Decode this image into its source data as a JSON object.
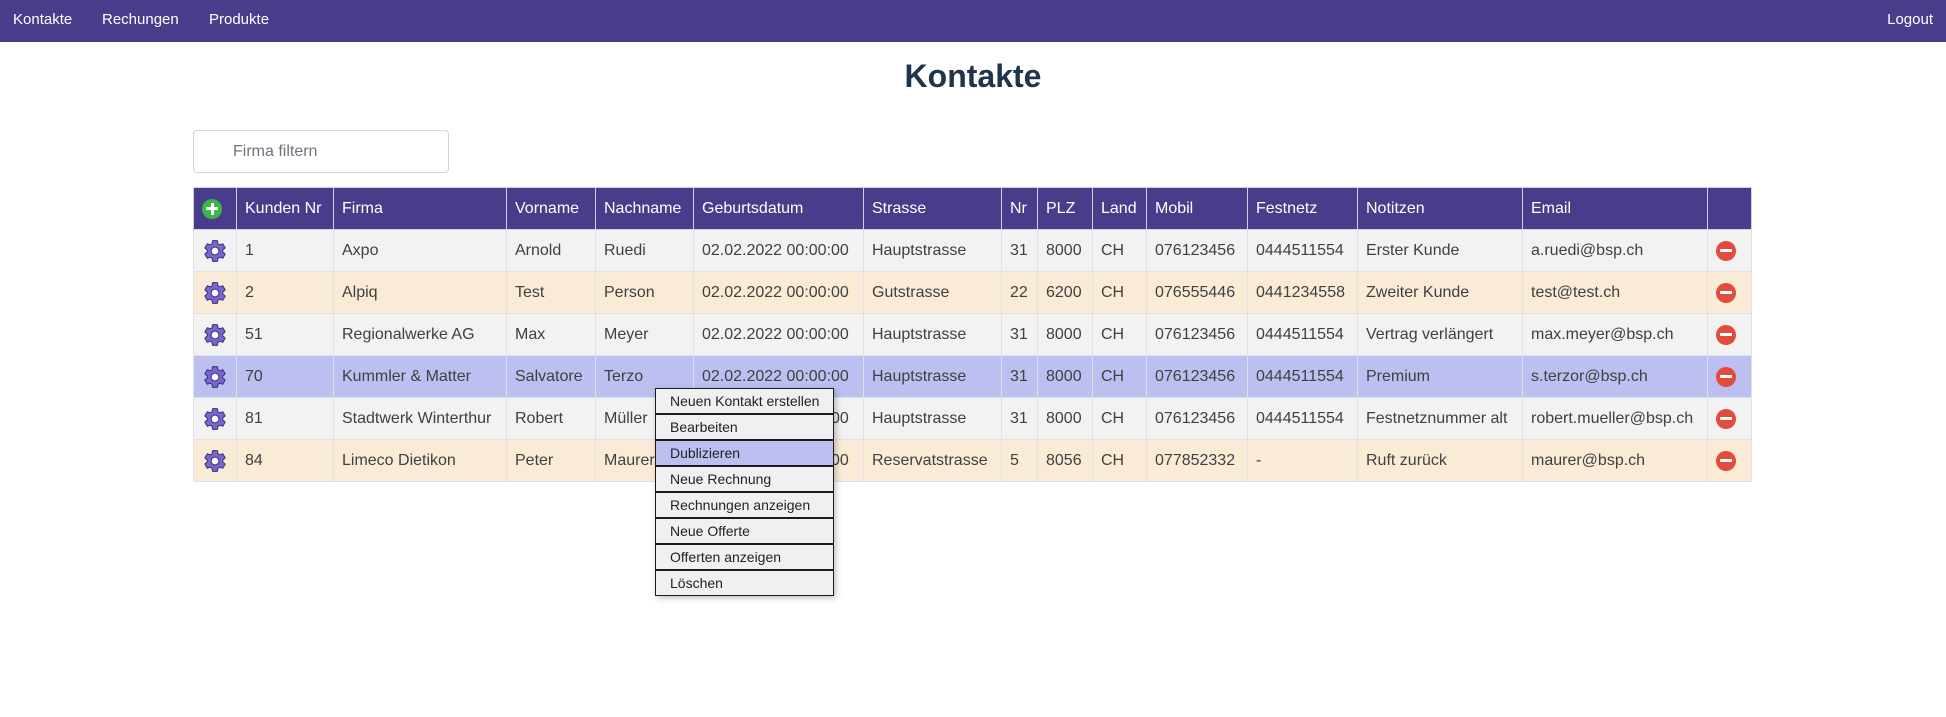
{
  "nav": {
    "links": [
      "Kontakte",
      "Rechungen",
      "Produkte"
    ],
    "logout": "Logout"
  },
  "page": {
    "title": "Kontakte"
  },
  "filter": {
    "placeholder": "Firma filtern",
    "value": ""
  },
  "table": {
    "columns": [
      "Kunden Nr",
      "Firma",
      "Vorname",
      "Nachname",
      "Geburtsdatum",
      "Strasse",
      "Nr",
      "PLZ",
      "Land",
      "Mobil",
      "Festnetz",
      "Notitzen",
      "Email"
    ],
    "rows": [
      [
        "1",
        "Axpo",
        "Arnold",
        "Ruedi",
        "02.02.2022 00:00:00",
        "Hauptstrasse",
        "31",
        "8000",
        "CH",
        "076123456",
        "0444511554",
        "Erster Kunde",
        "a.ruedi@bsp.ch"
      ],
      [
        "2",
        "Alpiq",
        "Test",
        "Person",
        "02.02.2022 00:00:00",
        "Gutstrasse",
        "22",
        "6200",
        "CH",
        "076555446",
        "0441234558",
        "Zweiter Kunde",
        "test@test.ch"
      ],
      [
        "51",
        "Regionalwerke AG",
        "Max",
        "Meyer",
        "02.02.2022 00:00:00",
        "Hauptstrasse",
        "31",
        "8000",
        "CH",
        "076123456",
        "0444511554",
        "Vertrag verlängert",
        "max.meyer@bsp.ch"
      ],
      [
        "70",
        "Kummler & Matter",
        "Salvatore",
        "Terzo",
        "02.02.2022 00:00:00",
        "Hauptstrasse",
        "31",
        "8000",
        "CH",
        "076123456",
        "0444511554",
        "Premium",
        "s.terzor@bsp.ch"
      ],
      [
        "81",
        "Stadtwerk Winterthur",
        "Robert",
        "Müller",
        "02.02.2022 00:00:00",
        "Hauptstrasse",
        "31",
        "8000",
        "CH",
        "076123456",
        "0444511554",
        "Festnetznummer alt",
        "robert.mueller@bsp.ch"
      ],
      [
        "84",
        "Limeco Dietikon",
        "Peter",
        "Maurer",
        "02.02.2022 00:00:00",
        "Reservatstrasse",
        "5",
        "8056",
        "CH",
        "077852332",
        "-",
        "Ruft zurück",
        "maurer@bsp.ch"
      ]
    ],
    "selected_row": 3
  },
  "context_menu": {
    "items": [
      "Neuen Kontakt erstellen",
      "Bearbeiten",
      "Dublizieren",
      "Neue Rechnung",
      "Rechnungen anzeigen",
      "Neue Offerte",
      "Offerten anzeigen",
      "Löschen"
    ],
    "active_index": 2
  },
  "icons": {
    "add": "plus-circle-icon",
    "row_action": "gear-icon",
    "delete": "minus-circle-icon"
  },
  "colors": {
    "navbar": "#483d8b",
    "header": "#483d8b",
    "row_odd": "#f2f2f2",
    "row_even": "#faebd7",
    "row_selected": "#bdbff0",
    "add": "#3cb54a",
    "delete": "#e14c3c",
    "title": "#203549"
  }
}
